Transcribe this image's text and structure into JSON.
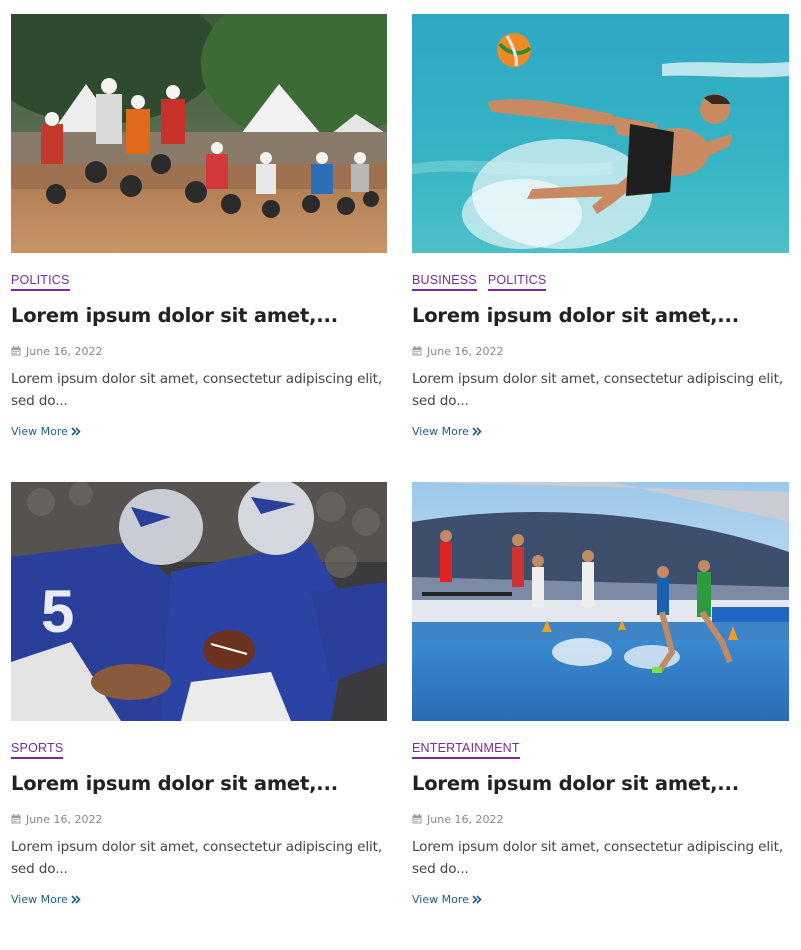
{
  "posts": [
    {
      "image": "motocross-race-photo",
      "categories": [
        "POLITICS"
      ],
      "title": "Lorem ipsum dolor sit amet,...",
      "date": "June 16, 2022",
      "excerpt": "Lorem ipsum dolor sit amet, consectetur adipiscing elit, sed do...",
      "more_label": "View More"
    },
    {
      "image": "beach-soccer-kick-photo",
      "categories": [
        "BUSINESS",
        "POLITICS"
      ],
      "title": "Lorem ipsum dolor sit amet,...",
      "date": "June 16, 2022",
      "excerpt": "Lorem ipsum dolor sit amet, consectetur adipiscing elit, sed do...",
      "more_label": "View More"
    },
    {
      "image": "american-football-photo",
      "categories": [
        "SPORTS"
      ],
      "title": "Lorem ipsum dolor sit amet,...",
      "date": "June 16, 2022",
      "excerpt": "Lorem ipsum dolor sit amet, consectetur adipiscing elit, sed do...",
      "more_label": "View More"
    },
    {
      "image": "steeplechase-water-jump-photo",
      "categories": [
        "ENTERTAINMENT"
      ],
      "title": "Lorem ipsum dolor sit amet,...",
      "date": "June 16, 2022",
      "excerpt": "Lorem ipsum dolor sit amet, consectetur adipiscing elit, sed do...",
      "more_label": "View More"
    }
  ],
  "colors": {
    "category": "#7b2a9e",
    "title": "#222222",
    "meta": "#888888",
    "excerpt": "#444444",
    "link": "#1b5f8c"
  },
  "icons": {
    "date": "calendar-icon",
    "more": "double-chevron-right-icon"
  }
}
